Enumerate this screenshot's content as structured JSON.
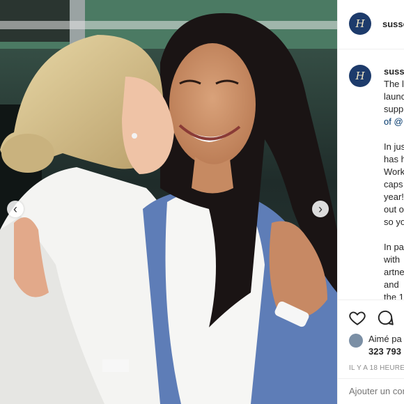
{
  "post": {
    "image_alt": "",
    "nav_prev": "‹",
    "nav_next": "›"
  },
  "header": {
    "avatar_monogram": "H",
    "username": "susse"
  },
  "caption": {
    "username": "suss",
    "paragraphs": [
      [
        "The l",
        "launc",
        "supp",
        "of @"
      ],
      [
        "In jus",
        "has h",
        "Work",
        "caps",
        "year!",
        "out o",
        "so yo"
      ],
      [
        "In pa",
        "with",
        "artne",
        "and",
        "the 1"
      ]
    ]
  },
  "actions": {
    "liked_text": "Aimé pa",
    "likes_count": "323 793",
    "timestamp": "IL Y A 18 HEURE",
    "comment_placeholder": "Ajouter un comm"
  },
  "colors": {
    "brand_navy": "#1d3b6b",
    "link": "#00376b",
    "muted": "#8e8e8e",
    "text": "#262626"
  }
}
